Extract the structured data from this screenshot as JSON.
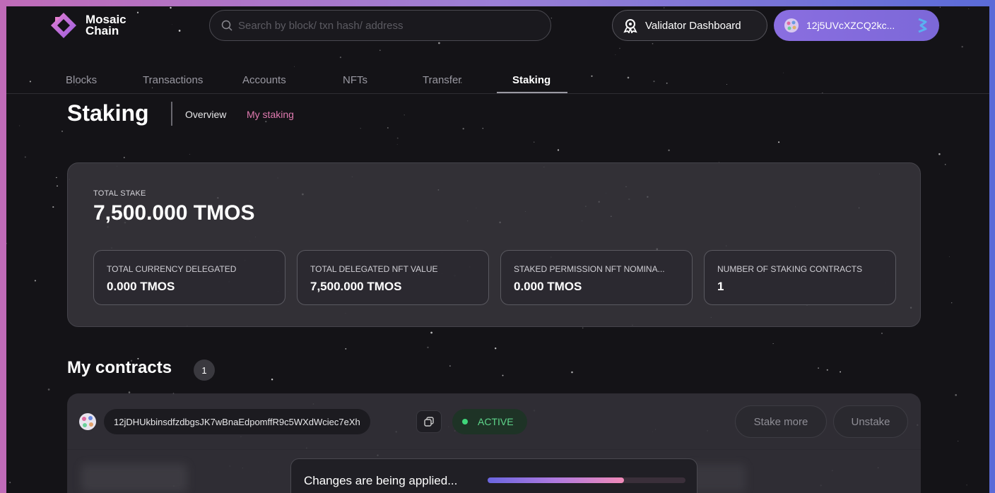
{
  "brand": {
    "line1": "Mosaic",
    "line2": "Chain"
  },
  "search": {
    "placeholder": "Search by block/ txn hash/ address"
  },
  "header": {
    "validator_label": "Validator Dashboard",
    "wallet_address": "12j5UVcXZCQ2kc..."
  },
  "nav": {
    "items": [
      "Blocks",
      "Transactions",
      "Accounts",
      "NFTs",
      "Transfer",
      "Staking"
    ],
    "active": "Staking"
  },
  "page": {
    "title": "Staking",
    "subtabs": [
      "Overview",
      "My staking"
    ],
    "active_subtab": "My staking"
  },
  "stake": {
    "total_label": "TOTAL STAKE",
    "total_value": "7,500.000 TMOS",
    "cards": [
      {
        "label": "TOTAL CURRENCY DELEGATED",
        "value": "0.000 TMOS"
      },
      {
        "label": "TOTAL DELEGATED NFT VALUE",
        "value": "7,500.000 TMOS"
      },
      {
        "label": "STAKED PERMISSION NFT NOMINA...",
        "value": "0.000 TMOS"
      },
      {
        "label": "NUMBER OF STAKING CONTRACTS",
        "value": "1"
      }
    ]
  },
  "contracts": {
    "title": "My contracts",
    "count": "1",
    "items": [
      {
        "address": "12jDHUkbinsdfzdbgsJK7wBnaEdpomffR9c5WXdWciec7eXh",
        "status": "ACTIVE",
        "stake_more_label": "Stake more",
        "unstake_label": "Unstake"
      }
    ]
  },
  "toast": {
    "message": "Changes are being applied...",
    "progress": 0.69
  },
  "colors": {
    "accent_pink": "#e07ab0",
    "active_green": "#5fd68b",
    "wallet_purple": "#8a6ee0"
  }
}
